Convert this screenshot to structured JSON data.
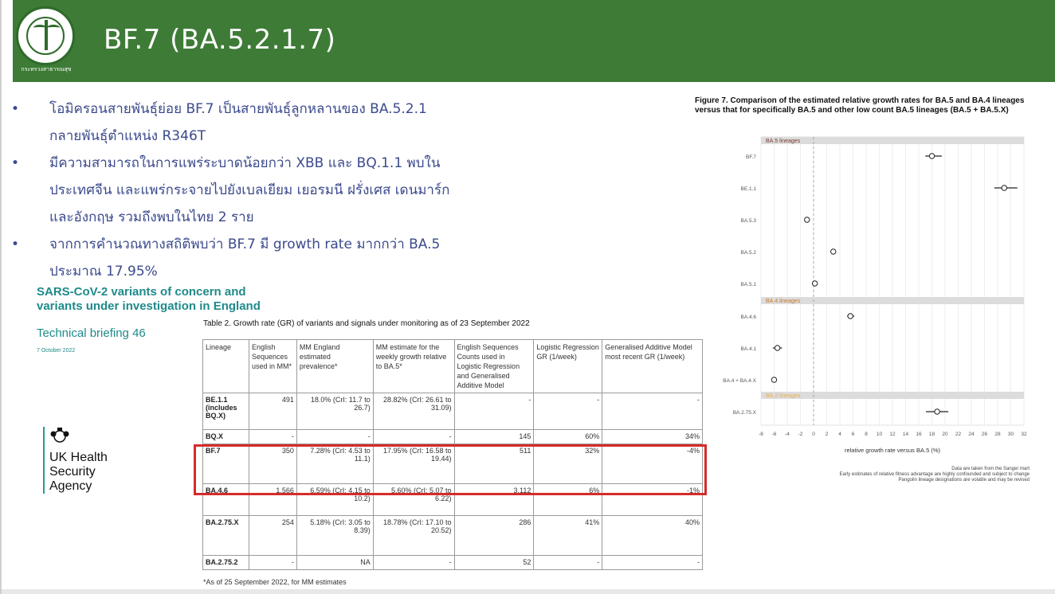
{
  "header": {
    "title": "BF.7 (BA.5.2.1.7)",
    "logo_caption": "กระทรวงสาธารณสุข",
    "logo_icon": "ministry-of-public-health-seal",
    "bg_color": "#3e7b37"
  },
  "bullets": [
    {
      "line1": "โอมิครอนสายพันธุ์ย่อย  BF.7   เป็นสายพันธุ์ลูกหลานของ BA.5.2.1",
      "line2": "กลายพันธุ์ตำแหน่ง R346T"
    },
    {
      "line1": "มีความสามารถในการแพร่ระบาดน้อยกว่า XBB  และ BQ.1.1  พบใน",
      "line2": "ประเทศจีน และแพร่กระจายไปยังเบลเยียม เยอรมนี ฝรั่งเศส เดนมาร์ก",
      "line3": "และอังกฤษ รวมถึงพบในไทย 2 ราย"
    },
    {
      "line1": "จากการคำนวณทางสถิติพบว่า BF.7  มี growth  rate  มากกว่า BA.5",
      "line2": "ประมาณ 17.95%"
    }
  ],
  "report": {
    "heading_line1": "SARS-CoV-2 variants of concern and",
    "heading_line2": "variants under investigation in England",
    "subtitle": "Technical briefing 46",
    "date": "7 October 2022",
    "agency_line1": "UK Health",
    "agency_line2": "Security",
    "agency_line3": "Agency"
  },
  "table": {
    "caption": "Table 2. Growth rate (GR) of variants and signals under monitoring as of 23 September 2022",
    "headers": [
      "Lineage",
      "English Sequences used in MM*",
      "MM England estimated prevalence*",
      "MM estimate for the weekly growth relative to BA.5*",
      "English Sequences Counts used in Logistic Regression and Generalised Additive Model",
      "Logistic Regression GR (1/week)",
      "Generalised Additive Model most recent GR (1/week)"
    ],
    "rows": [
      [
        "BE.1.1 (includes BQ.X)",
        "491",
        "18.0% (CrI: 11.7 to 26.7)",
        "28.82% (CrI: 26.61 to 31.09)",
        "-",
        "-",
        "-"
      ],
      [
        "BQ.X",
        "-",
        "-",
        "-",
        "145",
        "60%",
        "34%"
      ],
      [
        "BF.7",
        "350",
        "7.28% (CrI: 4.53 to 11.1)",
        "17.95% (CrI: 16.58 to 19.44)",
        "511",
        "32%",
        "-4%"
      ],
      [
        "BA.4.6",
        "1,566",
        "6.59% (CrI: 4.15 to 10.2)",
        "5.60% (CrI: 5.07 to 6.22)",
        "3,112",
        "6%",
        "-1%"
      ],
      [
        "BA.2.75.X",
        "254",
        "5.18% (CrI: 3.05 to 8.39)",
        "18.78% (CrI: 17.10 to 20.52)",
        "286",
        "41%",
        "40%"
      ],
      [
        "BA.2.75.2",
        "-",
        "NA",
        "-",
        "52",
        "-",
        "-"
      ]
    ],
    "footnote": "*As of 25 September 2022, for MM estimates",
    "highlight_color": "#d62b2b"
  },
  "figure": {
    "caption": "Figure 7. Comparison of the estimated relative growth rates for BA.5 and BA.4 lineages versus that for specifically BA.5 and other low count BA.5 lineages (BA.5 + BA.5.X)",
    "source_line1": "Data are taken from the Sanger mart",
    "source_line2": "Early estimates of relative fitness advantage are highly confounded and subject to change",
    "source_line3": "Pangolin lineage designations are volatile and may be revised"
  },
  "chart_data": {
    "type": "scatter",
    "title": "Figure 7. Comparison of the estimated relative growth rates for BA.5 and BA.4 lineages versus that for specifically BA.5 and other low count BA.5 lineages (BA.5 + BA.5.X)",
    "xlabel": "relative growth rate versus BA.5 (%)",
    "ylabel": "",
    "xlim": [
      -8,
      32
    ],
    "xticks": [
      -8,
      -6,
      -4,
      -2,
      0,
      2,
      4,
      6,
      8,
      10,
      12,
      14,
      16,
      18,
      20,
      22,
      24,
      26,
      28,
      30,
      32
    ],
    "grid": true,
    "groups": [
      {
        "label": "BA.5 lineages",
        "color": "#7a3b2e",
        "points": [
          {
            "lineage": "BF.7",
            "value": 18,
            "low": 17,
            "high": 19.5
          },
          {
            "lineage": "BE.1.1",
            "value": 29,
            "low": 27.5,
            "high": 31
          },
          {
            "lineage": "BA.5.3",
            "value": -1,
            "low": -1.3,
            "high": -0.7
          },
          {
            "lineage": "BA.5.2",
            "value": 3,
            "low": 2.8,
            "high": 3.2
          },
          {
            "lineage": "BA.5.1",
            "value": 0.2,
            "low": 0,
            "high": 0.4
          }
        ]
      },
      {
        "label": "BA.4 lineages",
        "color": "#c87a2e",
        "points": [
          {
            "lineage": "BA.4.6",
            "value": 5.6,
            "low": 5.1,
            "high": 6.2
          },
          {
            "lineage": "BA.4.1",
            "value": -5.5,
            "low": -6.2,
            "high": -4.8
          },
          {
            "lineage": "BA.4 + BA.4.X",
            "value": -6,
            "low": -6.3,
            "high": -5.7
          }
        ]
      },
      {
        "label": "BA.2 lineages",
        "color": "#e8b050",
        "points": [
          {
            "lineage": "BA.2.75.X",
            "value": 18.8,
            "low": 17.1,
            "high": 20.5
          }
        ]
      }
    ]
  }
}
